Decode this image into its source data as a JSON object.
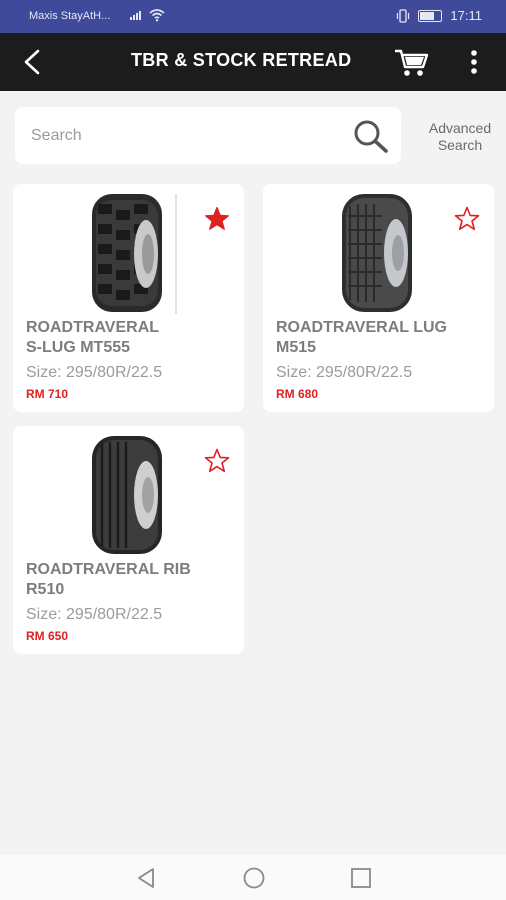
{
  "status_bar": {
    "carrier": "Maxis StayAtH...",
    "time": "17:11",
    "icons": [
      "signal-icon",
      "wifi-icon",
      "vibrate-icon",
      "battery-icon"
    ]
  },
  "app_bar": {
    "title": "TBR & STOCK RETREAD",
    "icons": [
      "back-arrow-icon",
      "cart-icon",
      "more-vert-icon"
    ]
  },
  "search": {
    "placeholder": "Search",
    "value": "",
    "advanced_line1": "Advanced",
    "advanced_line2": "Search"
  },
  "products": [
    {
      "name": "ROADTRAVERAL\nS-LUG MT555",
      "size": "Size: 295/80R/22.5",
      "price": "RM 710",
      "favorite": true,
      "tread": "lug"
    },
    {
      "name": "ROADTRAVERAL LUG\nM515",
      "size": "Size: 295/80R/22.5",
      "price": "RM 680",
      "favorite": false,
      "tread": "block"
    },
    {
      "name": "ROADTRAVERAL RIB\nR510",
      "size": "Size: 295/80R/22.5",
      "price": "RM 650",
      "favorite": false,
      "tread": "rib"
    }
  ],
  "colors": {
    "status_bar": "#3f4a9a",
    "app_bar": "#1c1c1c",
    "price": "#e02020",
    "favorite": "#e02020"
  },
  "nav_bar": {
    "icons": [
      "nav-back-icon",
      "nav-home-icon",
      "nav-recents-icon"
    ]
  }
}
